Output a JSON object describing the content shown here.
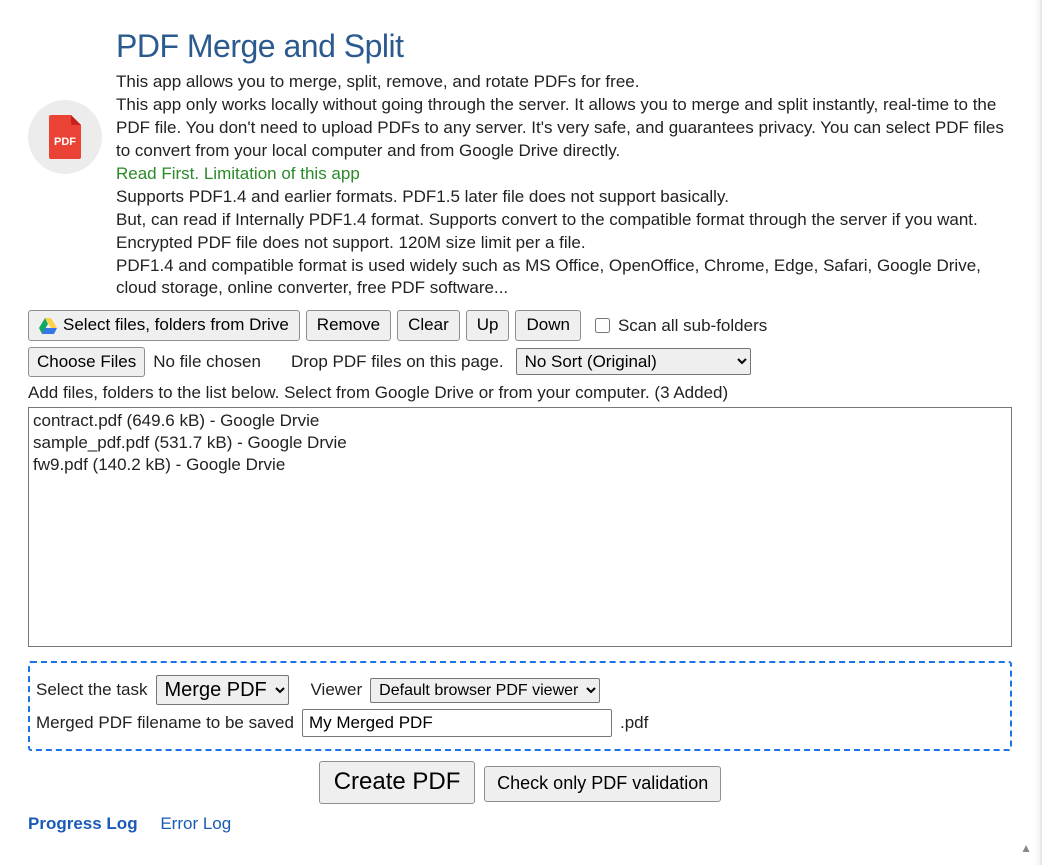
{
  "header": {
    "title": "PDF Merge and Split",
    "desc1": "This app allows you to merge, split, remove, and rotate PDFs for free.",
    "desc2": "This app only works locally without going through the server. It allows you to merge and split instantly, real-time to the PDF file. You don't need to upload PDFs to any server. It's very safe, and guarantees privacy. You can select PDF files to convert from your local computer and from Google Drive directly.",
    "limitation_title": "Read First. Limitation of this app",
    "limit1": "Supports PDF1.4 and earlier formats. PDF1.5 later file does not support basically.",
    "limit2": "But, can read if Internally PDF1.4 format. Supports convert to the compatible format through the server if you want. Encrypted PDF file does not support. 120M size limit per a file.",
    "limit3": "PDF1.4 and compatible format is used widely such as MS Office, OpenOffice, Chrome, Edge, Safari, Google Drive, cloud storage, online converter, free PDF software..."
  },
  "toolbar": {
    "drive_label": "Select files, folders from Drive",
    "remove_label": "Remove",
    "clear_label": "Clear",
    "up_label": "Up",
    "down_label": "Down",
    "scan_label": "Scan all sub-folders",
    "choose_label": "Choose Files",
    "nofile_label": "No file chosen",
    "drop_text": "Drop PDF files on this page.",
    "sort_selected": "No Sort (Original)"
  },
  "list": {
    "instruction": "Add files, folders to the list below. Select from Google Drive or from your computer. (3 Added)",
    "files": [
      "contract.pdf (649.6 kB) - Google Drvie",
      "sample_pdf.pdf (531.7 kB) - Google Drvie",
      "fw9.pdf (140.2 kB) - Google Drvie"
    ]
  },
  "options": {
    "task_label": "Select the task",
    "task_selected": "Merge PDF",
    "viewer_label": "Viewer",
    "viewer_selected": "Default browser PDF viewer",
    "filename_label": "Merged PDF filename to be saved",
    "filename_value": "My Merged PDF",
    "filename_suffix": ".pdf"
  },
  "actions": {
    "create_label": "Create PDF",
    "check_label": "Check only PDF validation"
  },
  "logs": {
    "progress": "Progress Log",
    "error": "Error Log"
  }
}
